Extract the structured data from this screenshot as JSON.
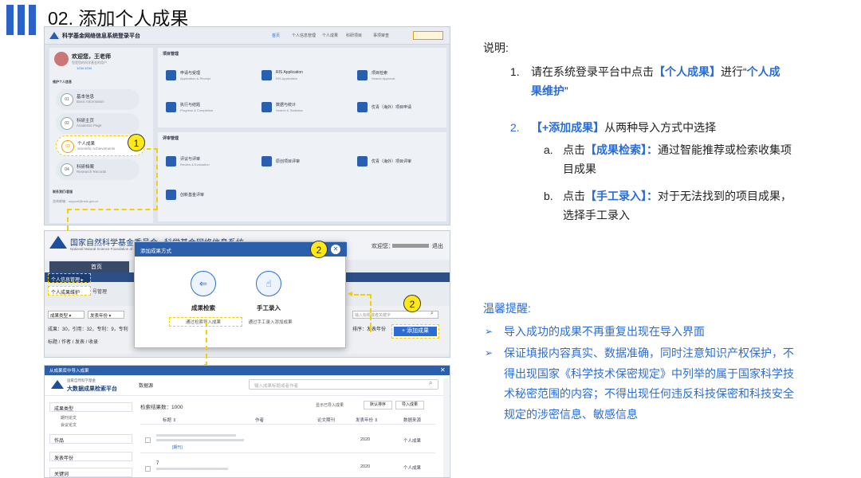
{
  "heading": "02. 添加个人成果",
  "panel1": {
    "platform": "科学基金网络信息系统登录平台",
    "nav": [
      "首页",
      "个人信息管理",
      "个人成果",
      "科研项目",
      "事项审查"
    ],
    "greet": "欢迎您，王老师",
    "greet_sub": "您是您的科学基金的用户",
    "phone": "1234.1234",
    "side_title": "维护个人信息",
    "menus": [
      {
        "n": "01",
        "l": "基本信息",
        "s": "Basic Information"
      },
      {
        "n": "02",
        "l": "科研主页",
        "s": "Academic Page"
      },
      {
        "n": "03",
        "l": "个人成果",
        "s": "Scientific Achievements"
      },
      {
        "n": "04",
        "l": "科研档案",
        "s": "Research Records"
      }
    ],
    "contact_title": "联系我们/客服",
    "contact": "咨询邮箱：support@nsfc.gov.cn",
    "sec1": "项目管理",
    "sec2": "评审管理",
    "items": [
      {
        "t": "申请与受理",
        "s": "Application & Receipt"
      },
      {
        "t": "RIS Application",
        "s": "RIS Application"
      },
      {
        "t": "项目检索",
        "s": "Search Approval"
      },
      {
        "t": "执行与结题",
        "s": "Progress & Completion"
      },
      {
        "t": "数据与统计",
        "s": "Search & Statistics"
      },
      {
        "t": "优青（海外）项目申请",
        "s": ""
      },
      {
        "t": "评议与评审",
        "s": "Review & Evaluation"
      },
      {
        "t": "原创项目评审",
        "s": ""
      },
      {
        "t": "优青（海外）项目评审",
        "s": ""
      },
      {
        "t": "创新基金评审",
        "s": ""
      }
    ],
    "badge": "1"
  },
  "panel2": {
    "org": "国家自然科学基金委员会",
    "org_en": "National Natural Science Foundation of China",
    "sys": "科学基金网络信息系统",
    "welcome": "欢迎您：",
    "logout": "退出",
    "tab": "首页",
    "menu_head": "个人信息管理 ▸",
    "menu_item": "个人成果维护",
    "menu_item2": "号管理",
    "filter1": "成果类型 ▾",
    "filter2": "发表年份 ▾",
    "stats": "成果：30，引用：32，专利：9，专利",
    "tags": "标题 / 作者 / 发表 / 收录",
    "search_ph": "输入标题或者关键字",
    "sort": "排序：发表年份",
    "add_btn": "+ 添加成果",
    "badge": "2",
    "dialog": {
      "title": "添加成果方式",
      "opt1": "成果检索",
      "opt1_sub": "通过检索导入成果",
      "opt2": "手工录入",
      "opt2_sub": "通过手工录入添加成果",
      "badge": "2"
    }
  },
  "panel3": {
    "title": "从成果库中导入成果",
    "brand": "大数据成果检索平台",
    "brand_top": "国家自然科学基金",
    "datasource": "数据源",
    "search_ph": "输入成果标题或者作者",
    "count": "检索结果数：1000",
    "btn1": "默认排序",
    "btn2": "导入成果",
    "chk": "显示已导入成果",
    "side": [
      "成果类型",
      "期刊论文",
      "会议论文",
      "作品",
      "发表年份",
      "关键词"
    ],
    "cols": [
      "标题 ⇕",
      "作者",
      "论文期刊",
      "发表年份 ⇕",
      "数据来源"
    ],
    "rows": [
      {
        "y": "2020",
        "s": "个人成果"
      },
      {
        "y": "2020",
        "s": "个人成果"
      }
    ],
    "tag": "[期刊]"
  },
  "right": {
    "note_title": "说明:",
    "s1_num": "1.",
    "s1_a": "请在系统登录平台中点击",
    "s1_b": "【个人成果】",
    "s1_c": "进行“",
    "s1_d": "个人成",
    "s1_e": "果维护",
    "s1_f": "”",
    "s2_num": "2.",
    "s2_a": "【+添加成果】",
    "s2_b": "从两种导入方式中选择",
    "a_num": "a.",
    "a_1": "点击",
    "a_2": "【成果检索】：",
    "a_3": "通过智能推荐或检索收集项",
    "a_4": "目成果",
    "b_num": "b.",
    "b_1": "点击",
    "b_2": "【手工录入】：",
    "b_3": "对于无法找到的项目成果，",
    "b_4": "选择手工录入",
    "tips_title": "温馨提醒:",
    "tip1": "导入成功的成果不再重复出现在导入界面",
    "tip2_1": "保证填报内容真实、数据准确，同时注意知识产权保护，不",
    "tip2_2": "得出现国家《科学技术保密规定》中列举的属于国家科学技",
    "tip2_3": "术秘密范围的内容；不得出现任何违反科技保密和科技安全",
    "tip2_4": "规定的涉密信息、敏感信息"
  }
}
